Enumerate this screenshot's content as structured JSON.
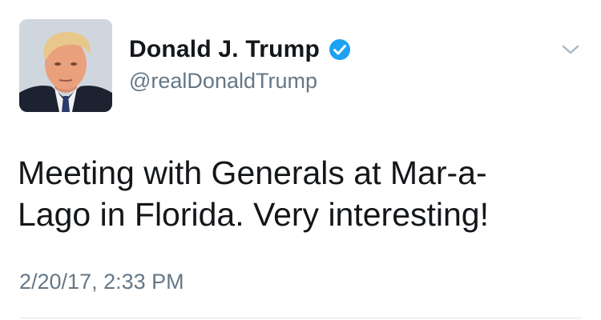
{
  "tweet": {
    "display_name": "Donald J. Trump",
    "handle": "@realDonaldTrump",
    "verified": true,
    "text_lines": [
      "Meeting with Generals at Mar-a-",
      "Lago in Florida. Very interesting!"
    ],
    "timestamp": "2/20/17, 2:33 PM"
  },
  "icons": {
    "verified": "verified-badge-icon",
    "menu": "chevron-down-icon",
    "avatar": "profile-photo"
  },
  "colors": {
    "text_primary": "#14171a",
    "text_secondary": "#657786",
    "verified_blue": "#1da1f2",
    "chevron": "#aab8c2",
    "divider": "#e1e8ed"
  }
}
